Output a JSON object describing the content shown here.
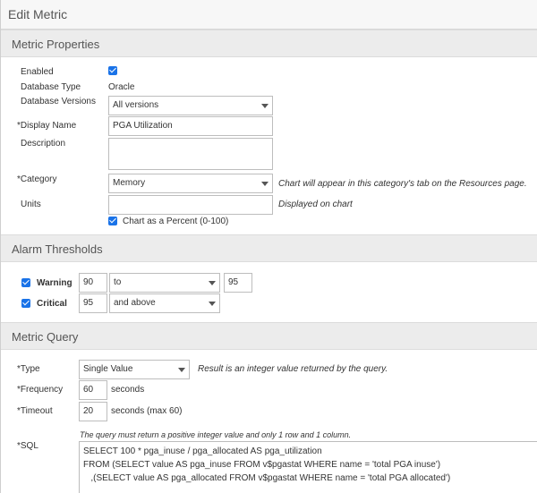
{
  "window": {
    "title": "Edit Metric"
  },
  "sections": {
    "properties": "Metric Properties",
    "alarms": "Alarm Thresholds",
    "query": "Metric Query"
  },
  "properties": {
    "enabled_label": "Enabled",
    "enabled_checked": true,
    "db_type_label": "Database Type",
    "db_type_value": "Oracle",
    "db_versions_label": "Database Versions",
    "db_versions_value": "All versions",
    "display_name_label": "*Display Name",
    "display_name_value": "PGA Utilization",
    "description_label": "Description",
    "description_value": "",
    "category_label": "*Category",
    "category_value": "Memory",
    "category_help": "Chart will appear in this category's tab on the Resources page.",
    "units_label": "Units",
    "units_value": "",
    "units_help": "Displayed on chart",
    "percent_checked": true,
    "percent_label": "Chart as a Percent (0-100)"
  },
  "alarms": {
    "warning": {
      "label": "Warning",
      "checked": true,
      "value": "90",
      "operator": "to",
      "upper": "95"
    },
    "critical": {
      "label": "Critical",
      "checked": true,
      "value": "95",
      "operator": "and above"
    }
  },
  "query": {
    "type_label": "*Type",
    "type_value": "Single Value",
    "type_help": "Result is an integer value returned by the query.",
    "frequency_label": "*Frequency",
    "frequency_value": "60",
    "frequency_unit": "seconds",
    "timeout_label": "*Timeout",
    "timeout_value": "20",
    "timeout_unit": "seconds (max 60)",
    "sql_note": "The query must return a positive integer value and only 1 row and 1 column.",
    "sql_label": "*SQL",
    "sql_lines": [
      "SELECT 100 * pga_inuse / pga_allocated AS pga_utilization",
      "FROM (SELECT value AS pga_inuse FROM v$pgastat WHERE name = 'total PGA inuse')",
      "   ,(SELECT value AS pga_allocated FROM v$pgastat WHERE name = 'total PGA allocated')"
    ]
  }
}
